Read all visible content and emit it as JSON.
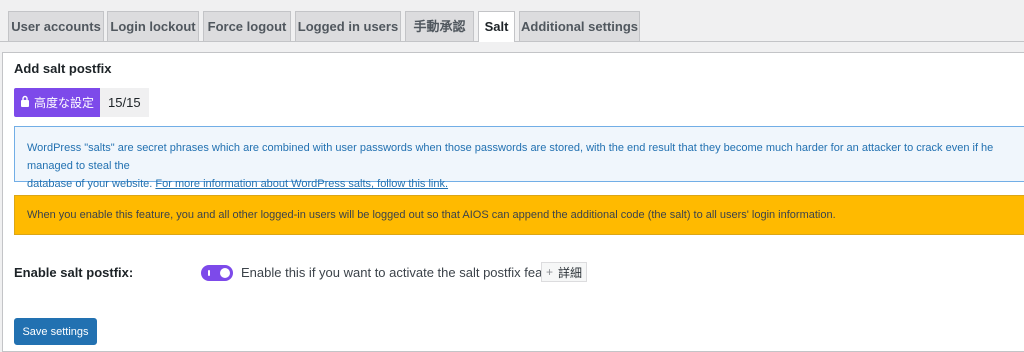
{
  "tabs": [
    {
      "label": "User accounts"
    },
    {
      "label": "Login lockout"
    },
    {
      "label": "Force logout"
    },
    {
      "label": "Logged in users"
    },
    {
      "label": "手動承認"
    },
    {
      "label": "Salt"
    },
    {
      "label": "Additional settings"
    }
  ],
  "active_tab": "Salt",
  "panel": {
    "title": "Add salt postfix",
    "premium_badge": "高度な設定",
    "premium_count": "15/15",
    "info_text": "WordPress \"salts\" are secret phrases which are combined with user passwords when those passwords are stored, with the end result that they become much harder for an attacker to crack even if he managed to steal the",
    "info_text2": "database of your website.",
    "info_link": "For more information about WordPress salts, follow this link.",
    "warning_text": "When you enable this feature, you and all other logged-in users will be logged out so that AIOS can append the additional code (the salt) to all users' login information.",
    "field_label": "Enable salt postfix:",
    "toggle_on": true,
    "field_desc": "Enable this if you want to activate the salt postfix feature.",
    "more_label": "詳細",
    "save_label": "Save settings"
  },
  "colors": {
    "accent_purple": "#7d4aea",
    "primary_blue": "#2271b1",
    "warning_yellow": "#ffba00"
  },
  "icons": {
    "premium": "lock-icon",
    "more": "plus-icon"
  }
}
